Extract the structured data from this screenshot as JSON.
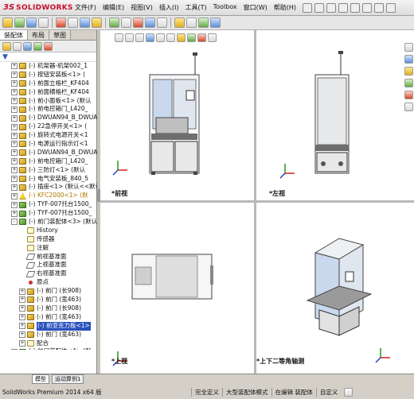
{
  "app": {
    "logo_mark": "3S",
    "logo_text": "SOLIDWORKS"
  },
  "menu": [
    "文件(F)",
    "编辑(E)",
    "视图(V)",
    "插入(I)",
    "工具(T)",
    "Toolbox",
    "窗口(W)",
    "帮助(H)"
  ],
  "panel_tabs": [
    "装配体",
    "布局",
    "草图"
  ],
  "tree": [
    {
      "label": "(-) 机架器-机架002_1",
      "icon": "part",
      "exp": "+"
    },
    {
      "label": "(-) 按钮安装板<1> (",
      "icon": "part",
      "exp": "+"
    },
    {
      "label": "(-) 前面立格栏_KF404",
      "icon": "part",
      "exp": "+"
    },
    {
      "label": "(-) 前面横格栏_KF404",
      "icon": "part",
      "exp": "+"
    },
    {
      "label": "(-) 前小面板<1> (默认",
      "icon": "part",
      "exp": "+"
    },
    {
      "label": "(-) 前电控箱门_L420_",
      "icon": "part",
      "exp": "+"
    },
    {
      "label": "(-) DWUAN94_B_DWUAN9",
      "icon": "part",
      "exp": "+"
    },
    {
      "label": "(-) 22急停开关<1> (",
      "icon": "part",
      "exp": "+"
    },
    {
      "label": "(-) 旋转式电源开关<1",
      "icon": "part",
      "exp": "+"
    },
    {
      "label": "(-) 电源运行指示灯<1",
      "icon": "part",
      "exp": "+"
    },
    {
      "label": "(-) DWUAN94_B_DWUAN9",
      "icon": "part",
      "exp": "+"
    },
    {
      "label": "(-) 前电控箱门_L420_",
      "icon": "part",
      "exp": "+"
    },
    {
      "label": "(-) 三防灯<1> (默认",
      "icon": "part",
      "exp": "+"
    },
    {
      "label": "(-) 电气安装板_840_5",
      "icon": "part",
      "exp": "+"
    },
    {
      "label": "(-) 插座<1> (默认<<默认",
      "icon": "part",
      "exp": "+"
    },
    {
      "label": "(-) KFC2000<1> (默",
      "icon": "warn",
      "exp": "+",
      "warn": true
    },
    {
      "label": "(-) TYF-007托台1500_",
      "icon": "asm",
      "exp": "+"
    },
    {
      "label": "(-) TYF-007托台1500_",
      "icon": "asm",
      "exp": "+"
    },
    {
      "label": "(-) 前门装配体<3> (默认",
      "icon": "asm",
      "exp": "-"
    },
    {
      "label": "History",
      "icon": "doc",
      "exp": "",
      "indent": 1
    },
    {
      "label": "传感器",
      "icon": "doc",
      "exp": "",
      "indent": 1
    },
    {
      "label": "注解",
      "icon": "doc",
      "exp": "",
      "indent": 1
    },
    {
      "label": "前视基准面",
      "icon": "plane",
      "exp": "",
      "indent": 1
    },
    {
      "label": "上视基准面",
      "icon": "plane",
      "exp": "",
      "indent": 1
    },
    {
      "label": "右视基准面",
      "icon": "plane",
      "exp": "",
      "indent": 1
    },
    {
      "label": "原点",
      "icon": "pt",
      "exp": "",
      "indent": 1
    },
    {
      "label": "(-) 前门 (长908)",
      "icon": "part",
      "exp": "+",
      "indent": 1
    },
    {
      "label": "(-) 前门 (宽463)",
      "icon": "part",
      "exp": "+",
      "indent": 1
    },
    {
      "label": "(-) 前门 (长908)",
      "icon": "part",
      "exp": "+",
      "indent": 1
    },
    {
      "label": "(-) 前门 (宽463)",
      "icon": "part",
      "exp": "+",
      "indent": 1
    },
    {
      "label": "(-) 前亚克力板<1>",
      "icon": "part",
      "exp": "+",
      "indent": 1,
      "selected": true
    },
    {
      "label": "(-) 前门 (宽463)",
      "icon": "part",
      "exp": "+",
      "indent": 1
    },
    {
      "label": "配合",
      "icon": "doc",
      "exp": "+",
      "indent": 1
    },
    {
      "label": "(-) 前门装配体<4> (默",
      "icon": "asm",
      "exp": "+"
    }
  ],
  "bottom_tabs": [
    "模型",
    "运动算例1"
  ],
  "views": {
    "front": "*前视",
    "left": "*左视",
    "top": "*上视",
    "iso": "*上下二等角轴测"
  },
  "status": {
    "app_version": "SolidWorks Premium 2014 x64 版",
    "fully_defined": "完全定义",
    "large_asm": "大型装配体模式",
    "editing": "在编辑 装配体",
    "custom": "自定义"
  },
  "colors": {
    "frame_gray": "#6e6e6e",
    "panel_glass": "#c9d8ec",
    "triad_red": "#d22020",
    "triad_green": "#1c9a1c",
    "triad_blue": "#2a3fcf"
  }
}
